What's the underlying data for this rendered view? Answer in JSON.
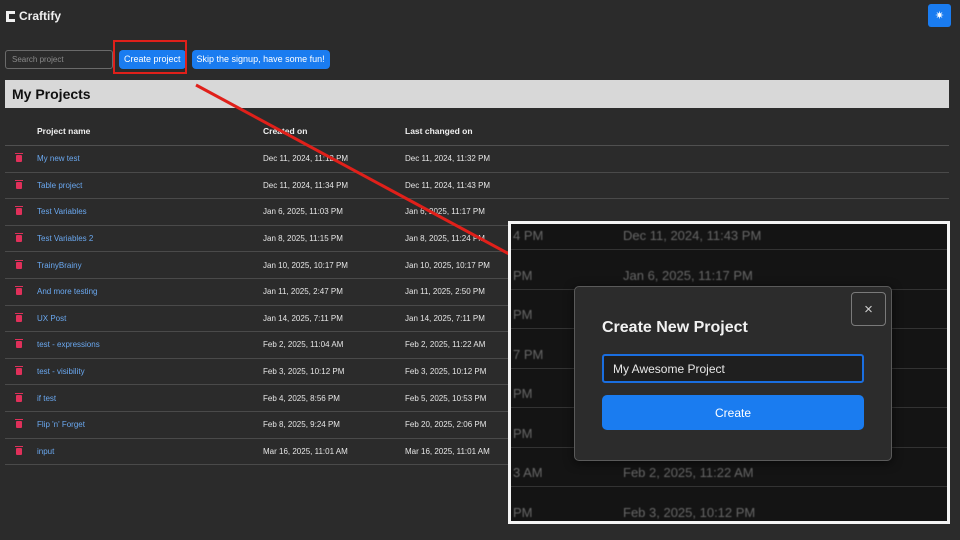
{
  "app": {
    "name": "Craftify",
    "theme_toggle_icon": "sun-icon"
  },
  "toolbar": {
    "search_placeholder": "Search project",
    "create_label": "Create project",
    "skip_label": "Skip the signup, have some fun!"
  },
  "section": {
    "title": "My Projects"
  },
  "table": {
    "headers": [
      "Project name",
      "Created on",
      "Last changed on"
    ],
    "rows": [
      {
        "name": "My new test",
        "created": "Dec 11, 2024, 11:12 PM",
        "changed": "Dec 11, 2024, 11:32 PM"
      },
      {
        "name": "Table project",
        "created": "Dec 11, 2024, 11:34 PM",
        "changed": "Dec 11, 2024, 11:43 PM"
      },
      {
        "name": "Test Variables",
        "created": "Jan 6, 2025, 11:03 PM",
        "changed": "Jan 6, 2025, 11:17 PM"
      },
      {
        "name": "Test Variables 2",
        "created": "Jan 8, 2025, 11:15 PM",
        "changed": "Jan 8, 2025, 11:24 PM"
      },
      {
        "name": "TrainyBrainy",
        "created": "Jan 10, 2025, 10:17 PM",
        "changed": "Jan 10, 2025, 10:17 PM"
      },
      {
        "name": "And more testing",
        "created": "Jan 11, 2025, 2:47 PM",
        "changed": "Jan 11, 2025, 2:50 PM"
      },
      {
        "name": "UX Post",
        "created": "Jan 14, 2025, 7:11 PM",
        "changed": "Jan 14, 2025, 7:11 PM"
      },
      {
        "name": "test - expressions",
        "created": "Feb 2, 2025, 11:04 AM",
        "changed": "Feb 2, 2025, 11:22 AM"
      },
      {
        "name": "test - visibility",
        "created": "Feb 3, 2025, 10:12 PM",
        "changed": "Feb 3, 2025, 10:12 PM"
      },
      {
        "name": "if test",
        "created": "Feb 4, 2025, 8:56 PM",
        "changed": "Feb 5, 2025, 10:53 PM"
      },
      {
        "name": "Flip 'n' Forget",
        "created": "Feb 8, 2025, 9:24 PM",
        "changed": "Feb 20, 2025, 2:06 PM"
      },
      {
        "name": "input",
        "created": "Mar 16, 2025, 11:01 AM",
        "changed": "Mar 16, 2025, 11:01 AM"
      }
    ]
  },
  "zoom_background_rows": [
    {
      "left": "4 PM",
      "right": "Dec 11, 2024, 11:43 PM"
    },
    {
      "left": "PM",
      "right": "Jan 6, 2025, 11:17 PM"
    },
    {
      "left": "PM",
      "right": ""
    },
    {
      "left": "7 PM",
      "right": ""
    },
    {
      "left": "PM",
      "right": ""
    },
    {
      "left": "PM",
      "right": ""
    },
    {
      "left": "3 AM",
      "right": "Feb 2, 2025, 11:22 AM"
    },
    {
      "left": "PM",
      "right": "Feb 3, 2025, 10:12 PM"
    }
  ],
  "modal": {
    "title": "Create New Project",
    "close_glyph": "×",
    "input_value": "My Awesome Project",
    "create_label": "Create"
  },
  "colors": {
    "accent": "#1a7cf0",
    "highlight": "#e0201a",
    "delete": "#e0305a",
    "link": "#6aa8f0"
  }
}
